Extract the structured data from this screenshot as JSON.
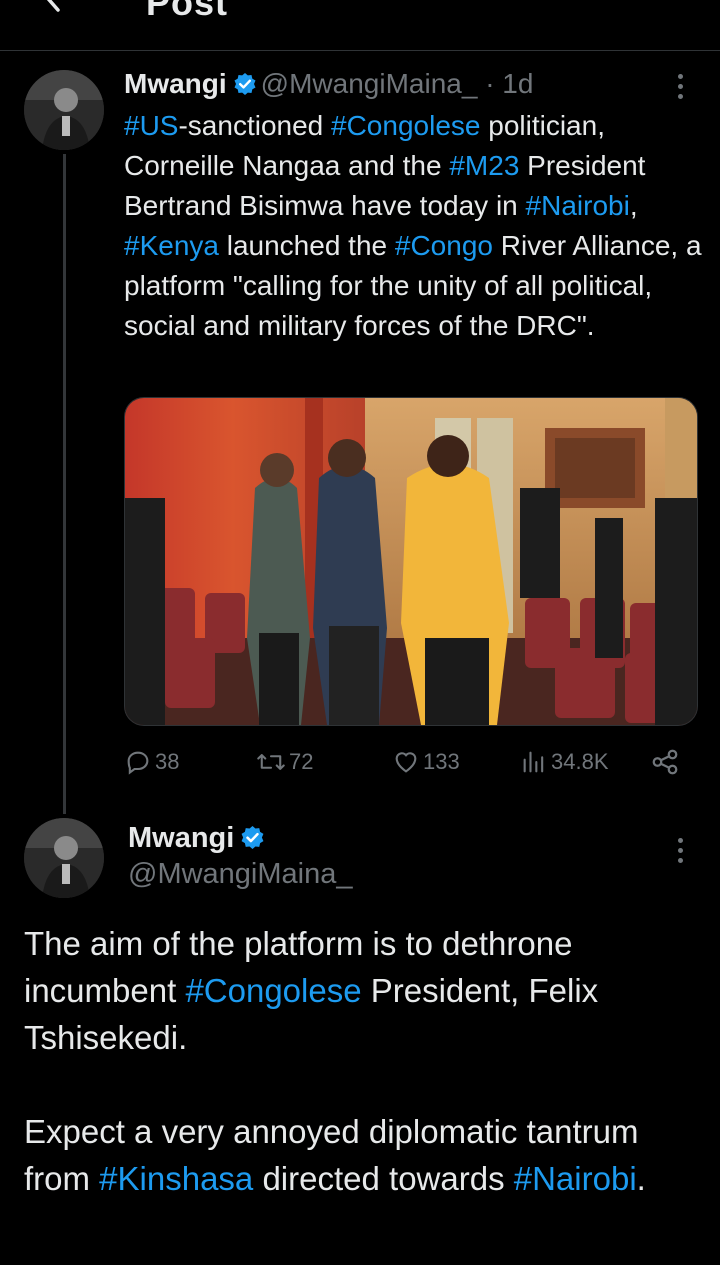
{
  "header": {
    "title": "Post",
    "back_icon": "arrow-left-icon"
  },
  "tweet1": {
    "name": "Mwangi",
    "handle": "@MwangiMaina_",
    "time": "· 1d",
    "text": [
      {
        "tag": "#US"
      },
      {
        "t": "-sanctioned "
      },
      {
        "tag": "#Congolese"
      },
      {
        "t": " politician, Corneille Nangaa and the "
      },
      {
        "tag": "#M23"
      },
      {
        "t": " President Bertrand Bisimwa have today in "
      },
      {
        "tag": "#Nairobi"
      },
      {
        "t": ", "
      },
      {
        "tag": "#Kenya"
      },
      {
        "t": " launched the "
      },
      {
        "tag": "#Congo"
      },
      {
        "t": " River Alliance, a platform \"calling for the unity of all political, social and military forces of the DRC\"."
      }
    ],
    "stats": {
      "replies": "38",
      "reposts": "72",
      "likes": "133",
      "views": "34.8K"
    }
  },
  "tweet2": {
    "name": "Mwangi",
    "handle": "@MwangiMaina_",
    "paragraph1": [
      {
        "t": "The aim of the platform is to dethrone incumbent "
      },
      {
        "tag": "#Congolese"
      },
      {
        "t": " President, Felix Tshisekedi."
      }
    ],
    "paragraph2": [
      {
        "t": "Expect a very annoyed diplomatic tantrum from "
      },
      {
        "tag": "#Kinshasa"
      },
      {
        "t": " directed towards "
      },
      {
        "tag": "#Nairobi"
      },
      {
        "t": "."
      }
    ]
  },
  "colors": {
    "background": "#000000",
    "text": "#e7e9ea",
    "muted": "#71767b",
    "accent": "#1d9bf0",
    "border": "#2f3336"
  }
}
